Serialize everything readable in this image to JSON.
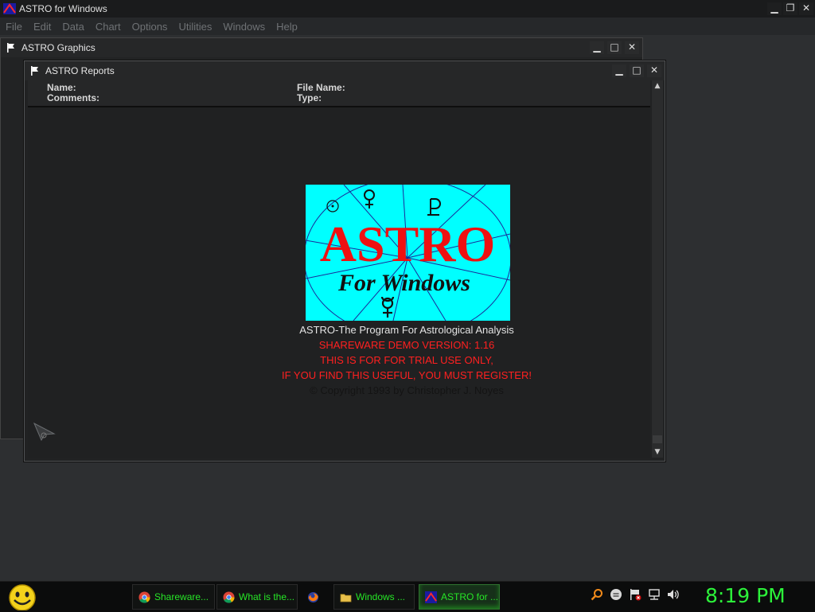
{
  "app": {
    "title": "ASTRO for Windows",
    "menu": [
      "File",
      "Edit",
      "Data",
      "Chart",
      "Options",
      "Utilities",
      "Windows",
      "Help"
    ],
    "controls": {
      "minimize": "▁",
      "restore": "❐",
      "close": "✕"
    }
  },
  "graphics_window": {
    "title": "ASTRO Graphics"
  },
  "reports_window": {
    "title": "ASTRO Reports",
    "header": {
      "name_label": "Name:",
      "comments_label": "Comments:",
      "file_name_label": "File Name:",
      "type_label": "Type:"
    }
  },
  "splash": {
    "logo_title": "ASTRO",
    "logo_subtitle": "For Windows",
    "program_line": "ASTRO-The Program For Astrological Analysis",
    "version_line": "SHAREWARE DEMO VERSION: 1.16",
    "trial_line": "THIS IS FOR FOR TRIAL USE ONLY,",
    "register_line": "IF YOU FIND THIS USEFUL, YOU MUST REGISTER!",
    "copyright_line": "© Copyright 1993 by Christopher J. Noyes",
    "colors": {
      "bg": "#00ffff",
      "title": "#ee1111",
      "accent_text": "#ff2020",
      "normal_text": "#e8e8e8",
      "copyright": "#111111"
    }
  },
  "taskbar": {
    "tasks": [
      {
        "label": "Shareware...",
        "icon": "chrome-icon"
      },
      {
        "label": "What is the...",
        "icon": "chrome-icon"
      },
      {
        "label": "",
        "icon": "firefox-icon"
      },
      {
        "label": "Windows ...",
        "icon": "folder-icon"
      },
      {
        "label": "ASTRO for ...",
        "icon": "astro-icon",
        "active": true
      }
    ],
    "clock": "8:19 PM",
    "accent": "#26e626"
  }
}
